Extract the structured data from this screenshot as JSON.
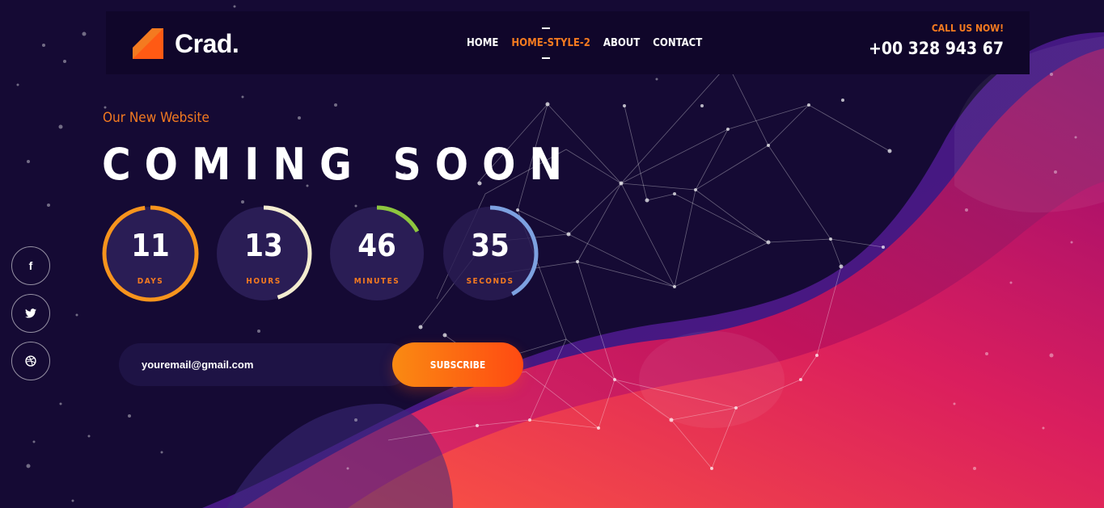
{
  "brand": {
    "name": "Crad.",
    "accent": "#f47a20"
  },
  "nav": [
    {
      "label": "HOME",
      "active": false
    },
    {
      "label": "HOME-STYLE-2",
      "active": true
    },
    {
      "label": "ABOUT",
      "active": false
    },
    {
      "label": "CONTACT",
      "active": false
    }
  ],
  "call": {
    "label": "CALL US NOW!",
    "number": "+00 328 943 67"
  },
  "hero": {
    "subtitle": "Our New Website",
    "title": "COMING SOON"
  },
  "countdown": [
    {
      "value": "11",
      "label": "DAYS",
      "progress": 0.98,
      "color": "#f7941d"
    },
    {
      "value": "13",
      "label": "HOURS",
      "progress": 0.45,
      "color": "#f3ecd0"
    },
    {
      "value": "46",
      "label": "MINUTES",
      "progress": 0.17,
      "color": "#8dc63f"
    },
    {
      "value": "35",
      "label": "SECONDS",
      "progress": 0.42,
      "color": "#7da1e0"
    }
  ],
  "social": [
    {
      "icon": "facebook-icon",
      "glyph": "f"
    },
    {
      "icon": "twitter-icon",
      "glyph": "t"
    },
    {
      "icon": "dribbble-icon",
      "glyph": "d"
    }
  ],
  "subscribe": {
    "email_value": "youremail@gmail.com",
    "button_label": "SUBSCRIBE"
  }
}
